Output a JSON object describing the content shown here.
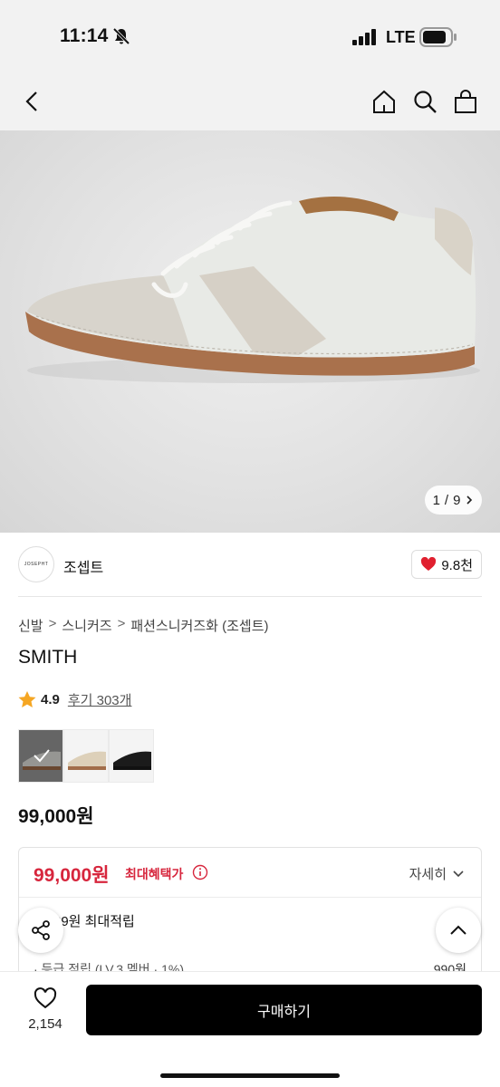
{
  "status": {
    "time": "11:14",
    "network": "LTE"
  },
  "hero": {
    "image_counter_current": "1",
    "image_counter_sep": "/",
    "image_counter_total": "9"
  },
  "brand": {
    "logo_text": "JOSEPHT",
    "name": "조셉트",
    "likes": "9.8천"
  },
  "breadcrumb": [
    "신발",
    "스니커즈",
    "패션스니커즈화 (조셉트)"
  ],
  "product": {
    "title": "SMITH",
    "rating": "4.9",
    "reviews": "후기 303개",
    "price": "99,000원"
  },
  "benefit": {
    "price": "99,000원",
    "label": "최대혜택가",
    "detail": "자세히",
    "points": "39원 최대적립",
    "grade_label": "· 등급 적립 (LV.3 멤버 · 1%)",
    "grade_value": "990원"
  },
  "bottom": {
    "wish_count": "2,154",
    "buy_label": "구매하기"
  },
  "colors": {
    "accent_red": "#d7263d",
    "heart_red": "#e0202f",
    "star": "#f5a623",
    "buy_button": "#000000"
  }
}
